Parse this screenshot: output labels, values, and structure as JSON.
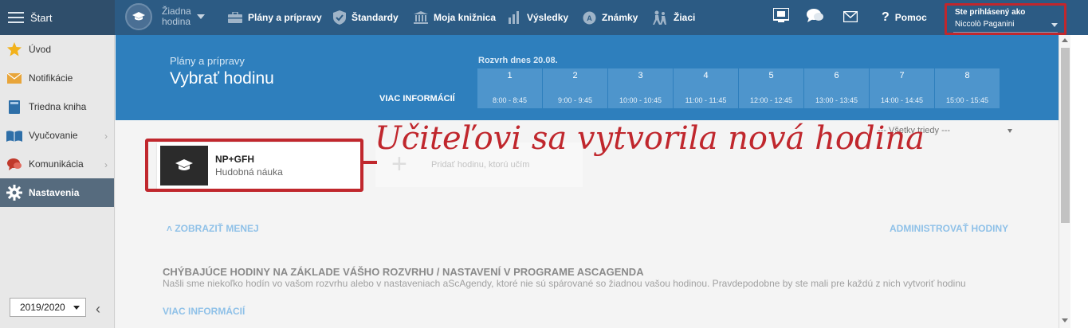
{
  "topbar": {
    "start_label": "Štart",
    "lesson_picker": {
      "label": "Žiadna hodina"
    },
    "nav": [
      {
        "label": "Plány a prípravy",
        "icon": "briefcase-icon"
      },
      {
        "label": "Štandardy",
        "icon": "shield-icon"
      },
      {
        "label": "Moja knižnica",
        "icon": "library-icon"
      },
      {
        "label": "Výsledky",
        "icon": "bar-chart-icon"
      },
      {
        "label": "Známky",
        "icon": "grades-icon"
      },
      {
        "label": "Žiaci",
        "icon": "students-icon"
      }
    ],
    "help_label": "Pomoc",
    "login": {
      "caption": "Ste prihlásený ako",
      "user": "Niccolò Paganini"
    }
  },
  "sidebar": {
    "items": [
      {
        "label": "Úvod",
        "icon": "star-icon"
      },
      {
        "label": "Notifikácie",
        "icon": "envelope-icon"
      },
      {
        "label": "Triedna kniha",
        "icon": "book-icon"
      },
      {
        "label": "Vyučovanie",
        "icon": "open-book-icon"
      },
      {
        "label": "Komunikácia",
        "icon": "chat-icon"
      },
      {
        "label": "Nastavenia",
        "icon": "gear-icon"
      }
    ],
    "year": "2019/2020"
  },
  "header": {
    "subtitle": "Plány a prípravy",
    "title": "Vybrať hodinu",
    "more_info": "VIAC INFORMÁCIÍ",
    "schedule_title": "Rozvrh dnes 20.08.",
    "periods": [
      {
        "n": "1",
        "time": "8:00 - 8:45"
      },
      {
        "n": "2",
        "time": "9:00 - 9:45"
      },
      {
        "n": "3",
        "time": "10:00 - 10:45"
      },
      {
        "n": "4",
        "time": "11:00 - 11:45"
      },
      {
        "n": "5",
        "time": "12:00 - 12:45"
      },
      {
        "n": "6",
        "time": "13:00 - 13:45"
      },
      {
        "n": "7",
        "time": "14:00 - 14:45"
      },
      {
        "n": "8",
        "time": "15:00 - 15:45"
      }
    ]
  },
  "content": {
    "class_filter": "--- Všetky triedy ---",
    "annotation": "Učiteľovi sa vytvorila nová hodina",
    "lesson_card": {
      "name": "NP+GFH",
      "subject": "Hudobná náuka"
    },
    "add_lesson": "Pridať hodinu, ktorú učím",
    "show_less": "ZOBRAZIŤ MENEJ",
    "admin_lessons": "ADMINISTROVAŤ HODINY",
    "missing": {
      "heading": "CHÝBAJÚCE HODINY NA ZÁKLADE VÁŠHO ROZVRHU / NASTAVENÍ V PROGRAME ASCAGENDA",
      "description": "Našli sme niekoľko hodín vo vašom rozvrhu alebo v nastaveniach aScAgendy, ktoré nie sú spárované so žiadnou vašou hodinou. Pravdepodobne by ste mali pre každú z nich vytvoriť hodinu",
      "more_info": "VIAC INFORMÁCIÍ"
    }
  },
  "colors": {
    "topbar": "#2c5b84",
    "band": "#2e7fbd",
    "highlight": "#c0272d",
    "link": "#8fc1e8"
  }
}
